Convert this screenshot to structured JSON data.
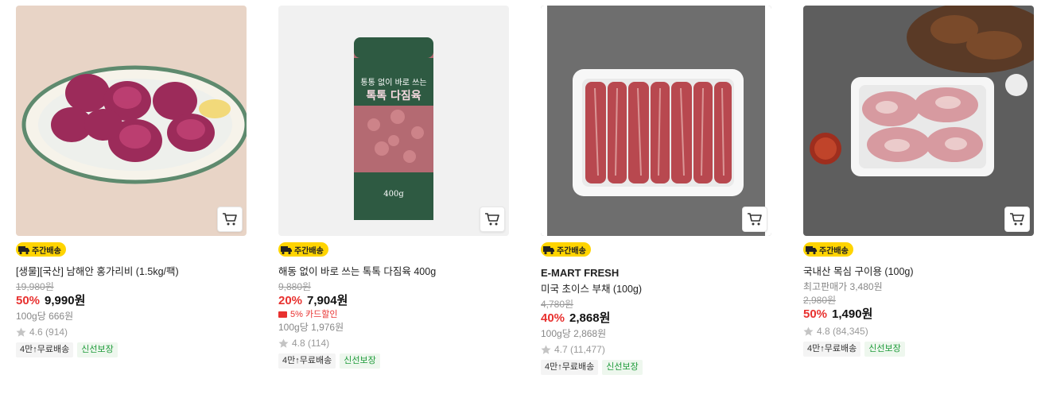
{
  "products": [
    {
      "image_desc": "scallops-plate",
      "badge": "주간배송",
      "name": "[생물][국산] 남해안 홍가리비 (1.5kg/팩)",
      "original_price": "19,980원",
      "discount": "50%",
      "price": "9,990원",
      "unit_price": "100g당 666원",
      "rating": "4.6",
      "reviews": "(914)",
      "tags": [
        "4만↑무료배송",
        "신선보장"
      ]
    },
    {
      "image_desc": "ground-meat-canister",
      "badge": "주간배송",
      "name": "해동 없이 바로 쓰는 톡톡 다짐육 400g",
      "original_price": "9,880원",
      "discount": "20%",
      "price": "7,904원",
      "card_sale": "5% 카드할인",
      "unit_price": "100g당 1,976원",
      "rating": "4.8",
      "reviews": "(114)",
      "tags": [
        "4만↑무료배송",
        "신선보장"
      ],
      "package_text": [
        "통통 없이 바로 쓰는",
        "톡톡 다짐육",
        "400g"
      ]
    },
    {
      "image_desc": "beef-tray",
      "badge": "주간배송",
      "brand": "E-MART FRESH",
      "name": "미국 초이스 부채 (100g)",
      "original_price": "4,780원",
      "discount": "40%",
      "price": "2,868원",
      "unit_price": "100g당 2,868원",
      "rating": "4.7",
      "reviews": "(11,477)",
      "tags": [
        "4만↑무료배송",
        "신선보장"
      ]
    },
    {
      "image_desc": "pork-tray",
      "badge": "주간배송",
      "name": "국내산 목심 구이용 (100g)",
      "best_price": "최고판매가 3,480원",
      "original_price": "2,980원",
      "discount": "50%",
      "price": "1,490원",
      "rating": "4.8",
      "reviews": "(84,345)",
      "tags": [
        "4만↑무료배송",
        "신선보장"
      ]
    }
  ],
  "icons": {
    "cart": "cart-icon",
    "truck": "truck-icon",
    "star": "star-icon",
    "card": "card-icon"
  },
  "colors": {
    "badge": "#ffd400",
    "discount": "#e8312f",
    "fresh_tag": "#1e9b3a"
  }
}
